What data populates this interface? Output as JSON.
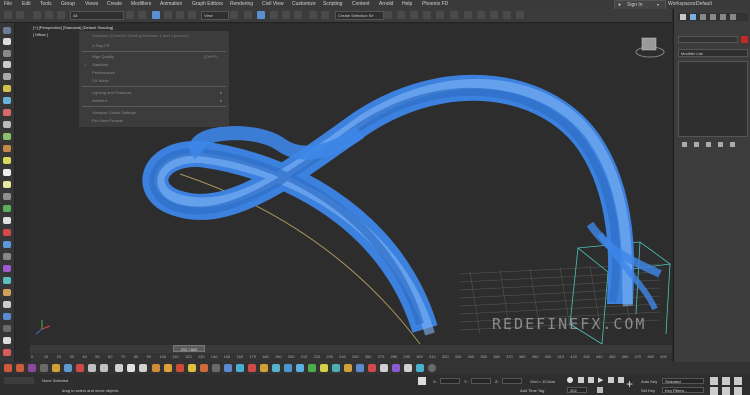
{
  "menubar": {
    "items": [
      "File",
      "Edit",
      "Tools",
      "Group",
      "Views",
      "Create",
      "Modifiers",
      "Animation",
      "Graph Editors",
      "Rendering",
      "Civil View",
      "Customize",
      "Scripting",
      "Content",
      "Arnold",
      "Help",
      "Phoenix FD"
    ],
    "sign_in": "Sign In",
    "workspace_label": "Workspaces:",
    "workspace_value": "Default"
  },
  "toolbar": {
    "filter_value": "All",
    "view_value": "View",
    "selection_set": "Create Selection Se"
  },
  "viewport": {
    "label": "[+] [Perspective] [Standard] [Default Shading]",
    "label2": "[ hfflow ]",
    "watermark": "REDEFINEFX.COM",
    "menu": {
      "header": "Standard (Override Shading Between 1 and 1 percent)",
      "items": [
        {
          "label": "X-Ray FR",
          "hotkey": ""
        },
        {
          "label": "High Quality",
          "hotkey": "(Ctrl+F)"
        },
        {
          "label": "Standard",
          "hotkey": ""
        },
        {
          "label": "Performance",
          "hotkey": ""
        },
        {
          "label": "DX Mode",
          "hotkey": ""
        },
        {
          "label": "Lighting and Shadows",
          "hotkey": "▸"
        },
        {
          "label": "Ambient",
          "hotkey": "▸"
        },
        {
          "label": "Viewport Global Settings",
          "hotkey": ""
        },
        {
          "label": "Per-View Presets",
          "hotkey": ""
        }
      ]
    }
  },
  "rightpanel": {
    "modifier_list": "Modifier List"
  },
  "timeslider": {
    "value": "202 / 800"
  },
  "ruler": {
    "ticks": [
      "0",
      "10",
      "20",
      "30",
      "40",
      "50",
      "60",
      "70",
      "80",
      "90",
      "100",
      "110",
      "120",
      "130",
      "140",
      "150",
      "160",
      "170",
      "180",
      "190",
      "200",
      "210",
      "220",
      "230",
      "240",
      "250",
      "260",
      "270",
      "280",
      "290",
      "300",
      "310",
      "320",
      "330",
      "340",
      "350",
      "360",
      "370",
      "380",
      "390",
      "400",
      "410",
      "420",
      "430",
      "440",
      "450",
      "460",
      "470",
      "480",
      "490"
    ]
  },
  "status": {
    "selection": "None Selected",
    "prompt": "drag to select and move objects",
    "x_label": "X:",
    "y_label": "Y:",
    "z_label": "Z:",
    "grid": "Grid = 10.0cm",
    "add_time_tag": "Add Time Tag",
    "auto_key": "Auto Key",
    "set_key": "Set Key",
    "selected": "Selected",
    "key_filters": "Key Filters...",
    "frame": "202"
  },
  "colors": {
    "hair": "#3d86e8",
    "accent": "#5a8fd0",
    "object_color": "#c22a2a"
  }
}
